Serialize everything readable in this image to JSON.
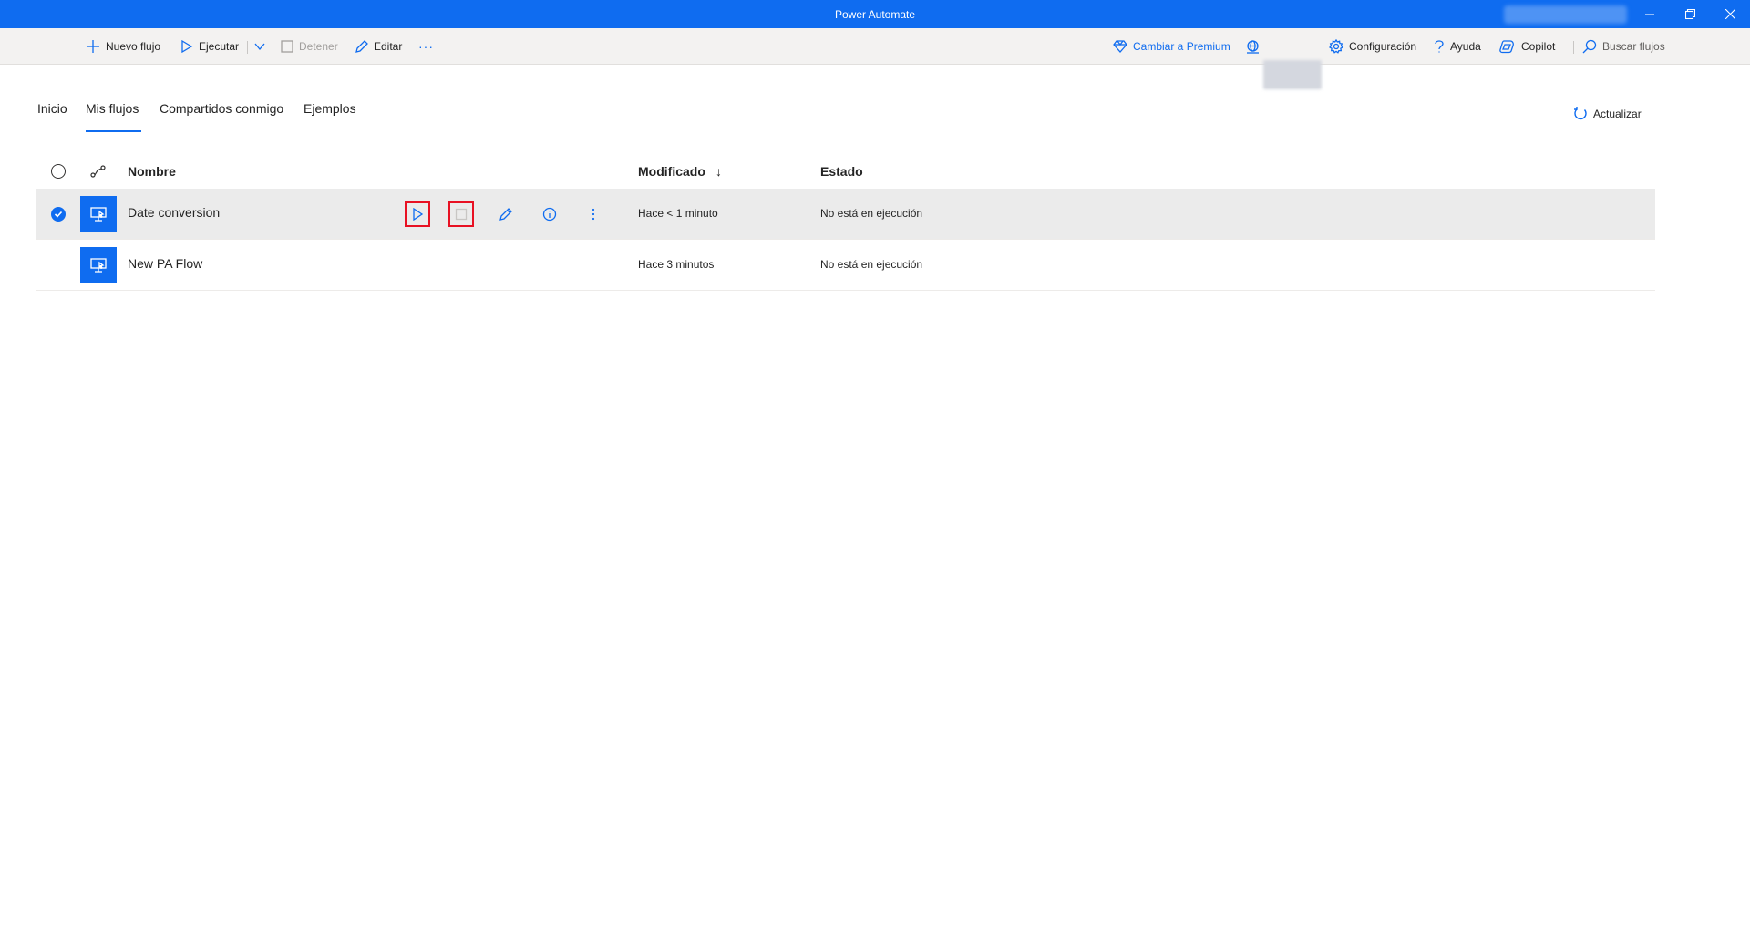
{
  "window": {
    "title": "Power Automate",
    "controls": [
      "minimize-icon",
      "restore-icon",
      "close-icon"
    ]
  },
  "toolbar": {
    "new_flow": "Nuevo flujo",
    "run": "Ejecutar",
    "stop": "Detener",
    "edit": "Editar",
    "more": "···",
    "premium": "Cambiar a Premium",
    "settings": "Configuración",
    "help": "Ayuda",
    "copilot": "Copilot",
    "search": "Buscar flujos"
  },
  "tabs": [
    {
      "label": "Inicio",
      "active": false
    },
    {
      "label": "Mis flujos",
      "active": true
    },
    {
      "label": "Compartidos conmigo",
      "active": false
    },
    {
      "label": "Ejemplos",
      "active": false
    }
  ],
  "refresh_label": "Actualizar",
  "table": {
    "columns": {
      "name": "Nombre",
      "modified": "Modificado",
      "sort_arrow": "↓",
      "status": "Estado"
    },
    "rows": [
      {
        "name": "Date conversion",
        "modified": "Hace < 1 minuto",
        "status": "No está en ejecución",
        "selected": true
      },
      {
        "name": "New PA Flow",
        "modified": "Hace 3 minutos",
        "status": "No está en ejecución",
        "selected": false
      }
    ]
  },
  "colors": {
    "accent": "#0f6cf0",
    "highlight_box": "#e81123",
    "selected_row": "#ebebeb"
  }
}
